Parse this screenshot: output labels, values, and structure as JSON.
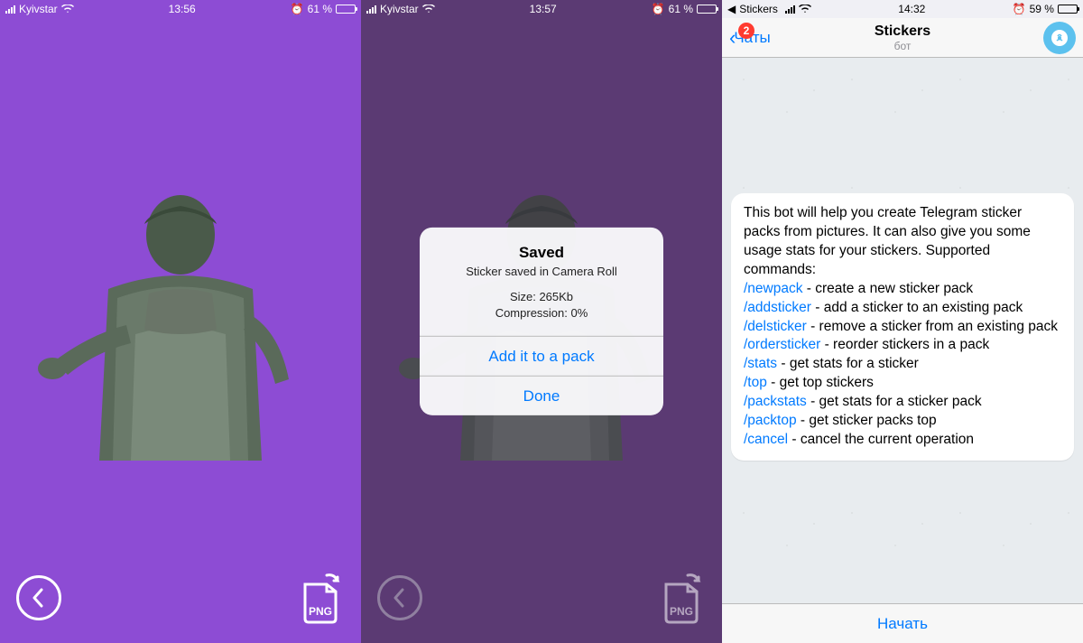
{
  "screen1": {
    "status": {
      "carrier": "Kyivstar",
      "time": "13:56",
      "battery_pct": "61 %"
    },
    "png_label": "PNG"
  },
  "screen2": {
    "status": {
      "carrier": "Kyivstar",
      "time": "13:57",
      "battery_pct": "61 %"
    },
    "alert": {
      "title": "Saved",
      "message": "Sticker saved in Camera Roll",
      "size": "Size: 265Kb",
      "compression": "Compression: 0%",
      "add_btn": "Add it to a pack",
      "done_btn": "Done"
    },
    "png_label": "PNG"
  },
  "screen3": {
    "breadcrumb": "Stickers",
    "status": {
      "time": "14:32",
      "battery_pct": "59 %"
    },
    "back_label": "Чаты",
    "badge": "2",
    "title": "Stickers",
    "subtitle": "бот",
    "message": {
      "intro": "This bot will help you create Telegram sticker packs from pictures. It can also give you some usage stats for your stickers. Supported commands:",
      "commands": [
        {
          "cmd": "/newpack",
          "desc": " - create a new sticker pack"
        },
        {
          "cmd": "/addsticker",
          "desc": " - add a sticker to an existing pack"
        },
        {
          "cmd": "/delsticker",
          "desc": " - remove a sticker from an existing pack"
        },
        {
          "cmd": "/ordersticker",
          "desc": " - reorder stickers in a pack"
        },
        {
          "cmd": "/stats",
          "desc": " - get stats for a sticker"
        },
        {
          "cmd": "/top",
          "desc": " - get top stickers"
        },
        {
          "cmd": "/packstats",
          "desc": " - get stats for a sticker pack"
        },
        {
          "cmd": "/packtop",
          "desc": " - get sticker packs top"
        },
        {
          "cmd": "/cancel",
          "desc": " - cancel the current operation"
        }
      ]
    },
    "start_btn": "Начать"
  }
}
